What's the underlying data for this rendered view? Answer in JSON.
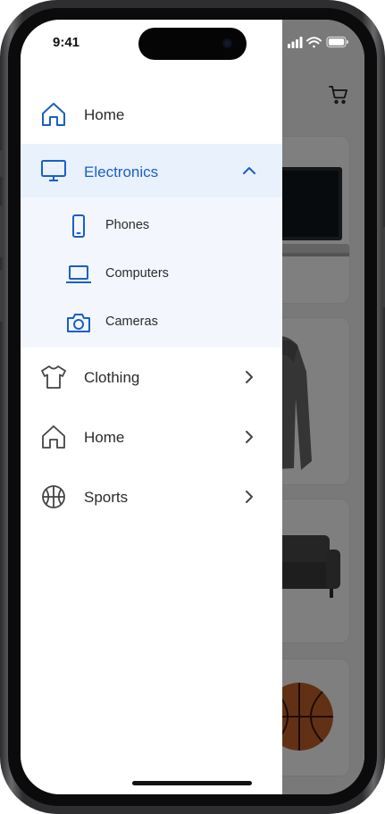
{
  "status_bar": {
    "time": "9:41"
  },
  "drawer": {
    "items": [
      {
        "label": "Home",
        "icon": "home-icon"
      },
      {
        "label": "Electronics",
        "icon": "monitor-icon",
        "expanded": true,
        "children": [
          {
            "label": "Phones",
            "icon": "phone-icon"
          },
          {
            "label": "Computers",
            "icon": "laptop-icon"
          },
          {
            "label": "Cameras",
            "icon": "camera-icon"
          }
        ]
      },
      {
        "label": "Clothing",
        "icon": "tshirt-icon"
      },
      {
        "label": "Home",
        "icon": "home-icon"
      },
      {
        "label": "Sports",
        "icon": "basketball-icon"
      }
    ]
  },
  "colors": {
    "accent": "#1a5fc7",
    "active_bg": "#e9f1fc",
    "expanded_bg": "#f3f7fd"
  }
}
